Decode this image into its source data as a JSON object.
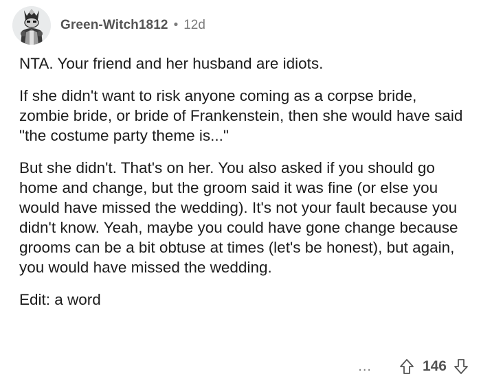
{
  "comment": {
    "author": "Green-Witch1812",
    "separator": "•",
    "age": "12d",
    "paragraphs": [
      "NTA. Your friend and her husband are idiots.",
      "If she didn't want to risk anyone coming as a corpse bride, zombie bride, or bride of Frankenstein, then she would have said \"the costume party theme is...\"",
      "But she didn't. That's on her. You also asked if you should go home and change, but the groom said it was fine (or else you would have missed the wedding). It's not your fault because you didn't know. Yeah, maybe you could have gone change because grooms can be a bit obtuse at times (let's be honest), but again, you would have missed the wedding.",
      "Edit: a word"
    ],
    "actions": {
      "more_label": "...",
      "score": "146",
      "upvote_icon": "arrow-up-outline-icon",
      "downvote_icon": "arrow-down-outline-icon"
    }
  },
  "colors": {
    "username": "#545454",
    "meta": "#7c7c7c",
    "text": "#1c1c1c",
    "avatar_bg": "#e9ebec"
  }
}
